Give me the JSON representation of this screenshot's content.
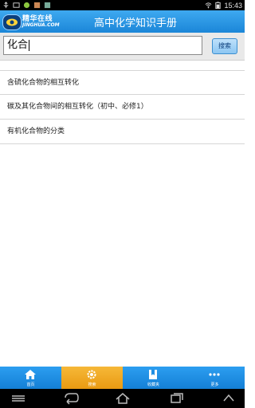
{
  "status_bar": {
    "time": "15:43",
    "left_icons": [
      "usb-icon",
      "screen-icon",
      "app-icon",
      "image-icon",
      "photo-icon"
    ],
    "right_icons": [
      "wifi-icon",
      "battery-icon"
    ]
  },
  "header": {
    "logo_cn": "精华在线",
    "logo_en": "JINGHUA.COM",
    "title": "高中化学知识手册"
  },
  "search": {
    "value": "化合",
    "button_label": "搜索"
  },
  "results": [
    {
      "label": "含硫化合物的相互转化"
    },
    {
      "label": "碳及其化合物间的相互转化（初中、必修1）"
    },
    {
      "label": "有机化合物的分类"
    }
  ],
  "tabs": [
    {
      "label": "首页",
      "icon": "home-icon",
      "active": false
    },
    {
      "label": "搜索",
      "icon": "gear-icon",
      "active": true
    },
    {
      "label": "收藏夹",
      "icon": "bookmark-icon",
      "active": false
    },
    {
      "label": "更多",
      "icon": "more-dots-icon",
      "active": false
    }
  ],
  "colors": {
    "header": "#2a97e6",
    "tabbar": "#1f8fe3",
    "tab_active": "#f0a825"
  },
  "nav_buttons": [
    "back-icon",
    "home-nav-icon",
    "recent-apps-icon",
    "screenshot-icon"
  ]
}
